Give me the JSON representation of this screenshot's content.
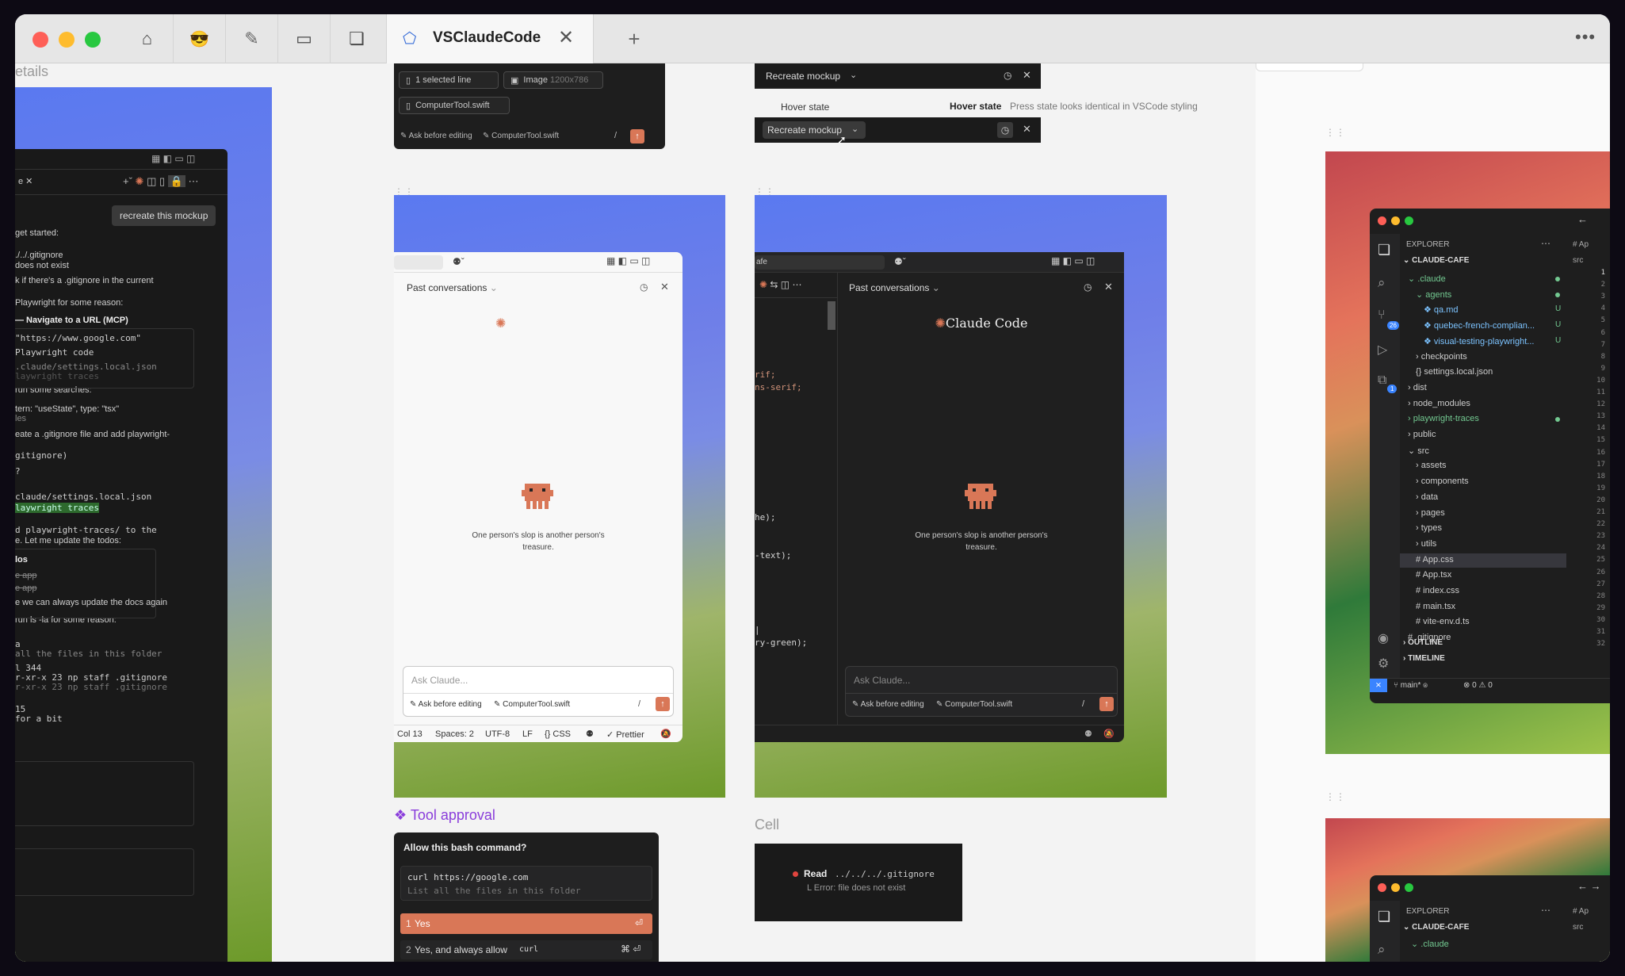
{
  "window": {
    "active_tab": "VSClaudeCode",
    "tab_icons": [
      "home-icon",
      "sunglasses-emoji-icon",
      "ruler-icon",
      "monitor-icon",
      "book-icon"
    ],
    "colors": {
      "accent": "#d97757",
      "purple": "#8a3ddb"
    }
  },
  "left_panel": {
    "heading_fragment": "etails",
    "recreate_btn": "recreate this mockup",
    "lines": [
      "get started:",
      "./../.gitignore",
      "does not exist",
      "k if there's a .gitignore in the current",
      "Playwright for some reason:",
      "— Navigate to a URL (MCP)",
      "\"https://www.google.com\"",
      "Playwright code",
      ".claude/settings.local.json",
      "laywright traces",
      "run some searches:",
      "tern: \"useState\", type: \"tsx\"",
      "les",
      "eate a .gitignore file and add playwright-",
      "gitignore)",
      "?",
      "claude/settings.local.json",
      "laywright traces",
      "d playwright-traces/ to the",
      "e. Let me update the todos:",
      "los",
      "e app",
      "e app",
      "e we can always update the docs again",
      "run ls -la for some reason:",
      "a",
      "all the files in this folder",
      "l 344",
      "r-xr-x  23  np  staff  .gitignore",
      "r-xr-x  23  np  staff  .gitignore",
      "15",
      "for a bit"
    ]
  },
  "top_composer": {
    "chip1": "1 selected line",
    "chip2": "Image",
    "chip2_dim": "1200x786",
    "chip3": "ComputerTool.swift",
    "ask_before": "Ask before editing",
    "file": "ComputerTool.swift",
    "slash": "/"
  },
  "hover_demo": {
    "title": "Recreate mockup",
    "hover_label": "Hover state",
    "hover_title": "Hover state",
    "hover_desc": "Press state looks identical in VSCode styling",
    "btn": "Recreate mockup"
  },
  "light_panel": {
    "header": "Past conversations",
    "tagline_1": "One person's slop is another person's",
    "tagline_2": "treasure.",
    "placeholder": "Ask Claude...",
    "ask_before": "Ask before editing",
    "file": "ComputerTool.swift",
    "slash": "/",
    "status": [
      "Col 13",
      "Spaces: 2",
      "UTF-8",
      "LF",
      "CSS",
      "Prettier"
    ]
  },
  "dark_panel": {
    "tab_fragment": "afe",
    "header": "Past conversations",
    "brand": "Claude Code",
    "tagline_1": "One person's slop is another person's",
    "tagline_2": "treasure.",
    "placeholder": "Ask Claude...",
    "ask_before": "Ask before editing",
    "file": "ComputerTool.swift",
    "slash": "/",
    "code": [
      "rif;",
      "ns-serif;",
      "he);",
      "-text);",
      "ry-green);"
    ]
  },
  "tool_approval": {
    "title": "Tool approval",
    "question": "Allow this bash command?",
    "cmd": "curl https://google.com",
    "desc": "List all the files in this folder",
    "opt1_num": "1",
    "opt1": "Yes",
    "opt2_num": "2",
    "opt2": "Yes, and always allow",
    "opt2_code": "curl"
  },
  "cell": {
    "title": "Cell",
    "read": "Read",
    "path": "../../../.gitignore",
    "error": "L  Error: file does not exist"
  },
  "explorer": {
    "title": "EXPLORER",
    "root": "CLAUDE-CAFE",
    "items": [
      ".claude",
      "agents",
      "qa.md",
      "quebec-french-complian...",
      "visual-testing-playwright...",
      "checkpoints",
      "settings.local.json",
      "dist",
      "node_modules",
      "playwright-traces",
      "public",
      "src",
      "assets",
      "components",
      "data",
      "pages",
      "types",
      "utils",
      "App.css",
      "App.tsx",
      "index.css",
      "main.tsx",
      "vite-env.d.ts",
      ".gitignore"
    ],
    "outline": "OUTLINE",
    "timeline": "TIMELINE",
    "branch": "main*",
    "errors": "0",
    "warnings": "0",
    "src_label": "src",
    "badge_scm": "26",
    "badge_ext": "1",
    "line_numbers": [
      "1",
      "2",
      "3",
      "4",
      "5",
      "6",
      "7",
      "8",
      "9",
      "10",
      "11",
      "12",
      "13",
      "14",
      "15",
      "16",
      "17",
      "18",
      "19",
      "20",
      "21",
      "22",
      "23",
      "24",
      "25",
      "26",
      "27",
      "28",
      "29",
      "30",
      "31",
      "32"
    ],
    "u": "U"
  },
  "explorer2": {
    "title": "EXPLORER",
    "root": "CLAUDE-CAFE",
    "item": ".claude",
    "src_label": "src"
  }
}
